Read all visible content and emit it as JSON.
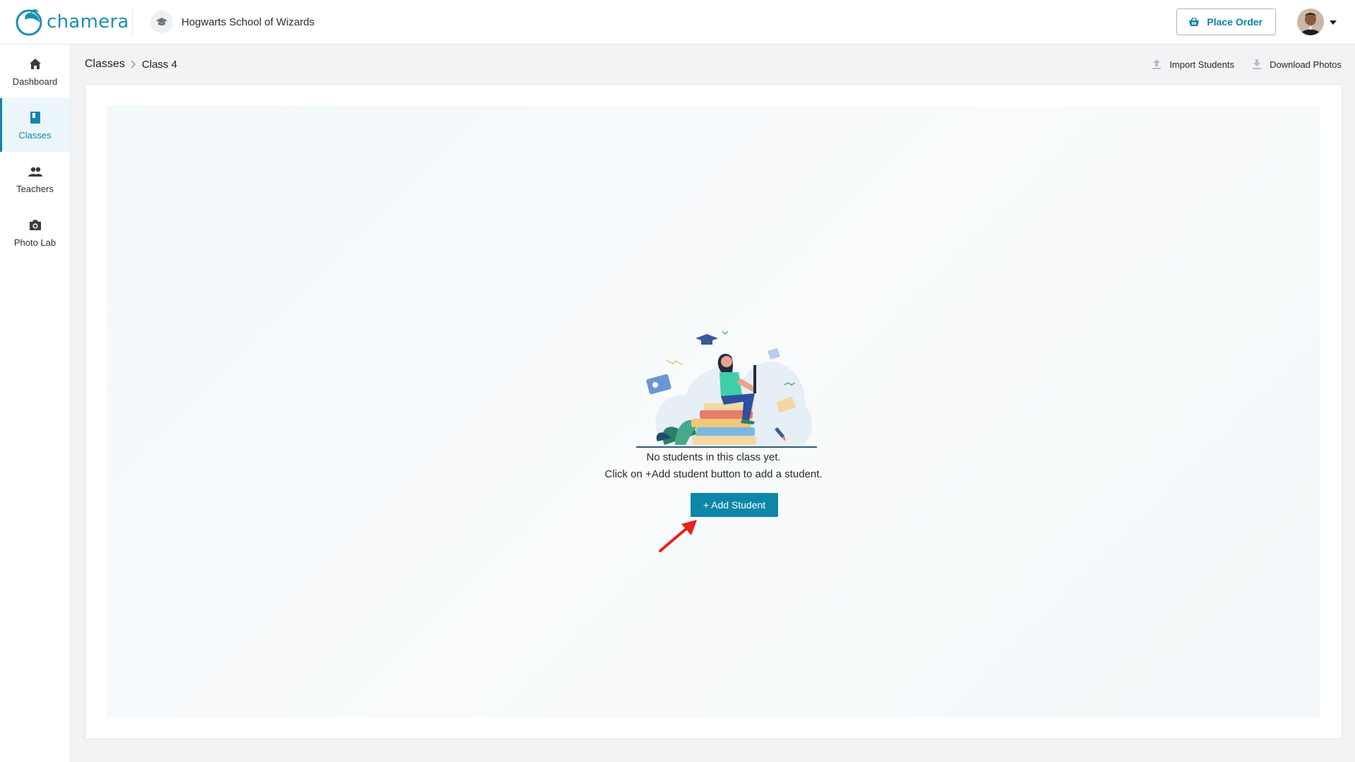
{
  "app": {
    "brand_name": "chamera",
    "school_name": "Hogwarts School of Wizards"
  },
  "header": {
    "place_order_label": "Place Order"
  },
  "sidebar": {
    "items": [
      {
        "label": "Dashboard",
        "icon": "home-icon",
        "active": false
      },
      {
        "label": "Classes",
        "icon": "book-icon",
        "active": true
      },
      {
        "label": "Teachers",
        "icon": "people-icon",
        "active": false
      },
      {
        "label": "Photo Lab",
        "icon": "camera-icon",
        "active": false
      }
    ]
  },
  "breadcrumb": {
    "root": "Classes",
    "current": "Class 4"
  },
  "actions": {
    "import_label": "Import Students",
    "download_label": "Download Photos"
  },
  "empty_state": {
    "line1": "No students in this class yet.",
    "line2": "Click on +Add student button to add a student.",
    "button_label": "+ Add Student"
  },
  "colors": {
    "brand": "#1a8fb3",
    "primary": "#0d86a9",
    "annotation_arrow": "#e8201f"
  }
}
